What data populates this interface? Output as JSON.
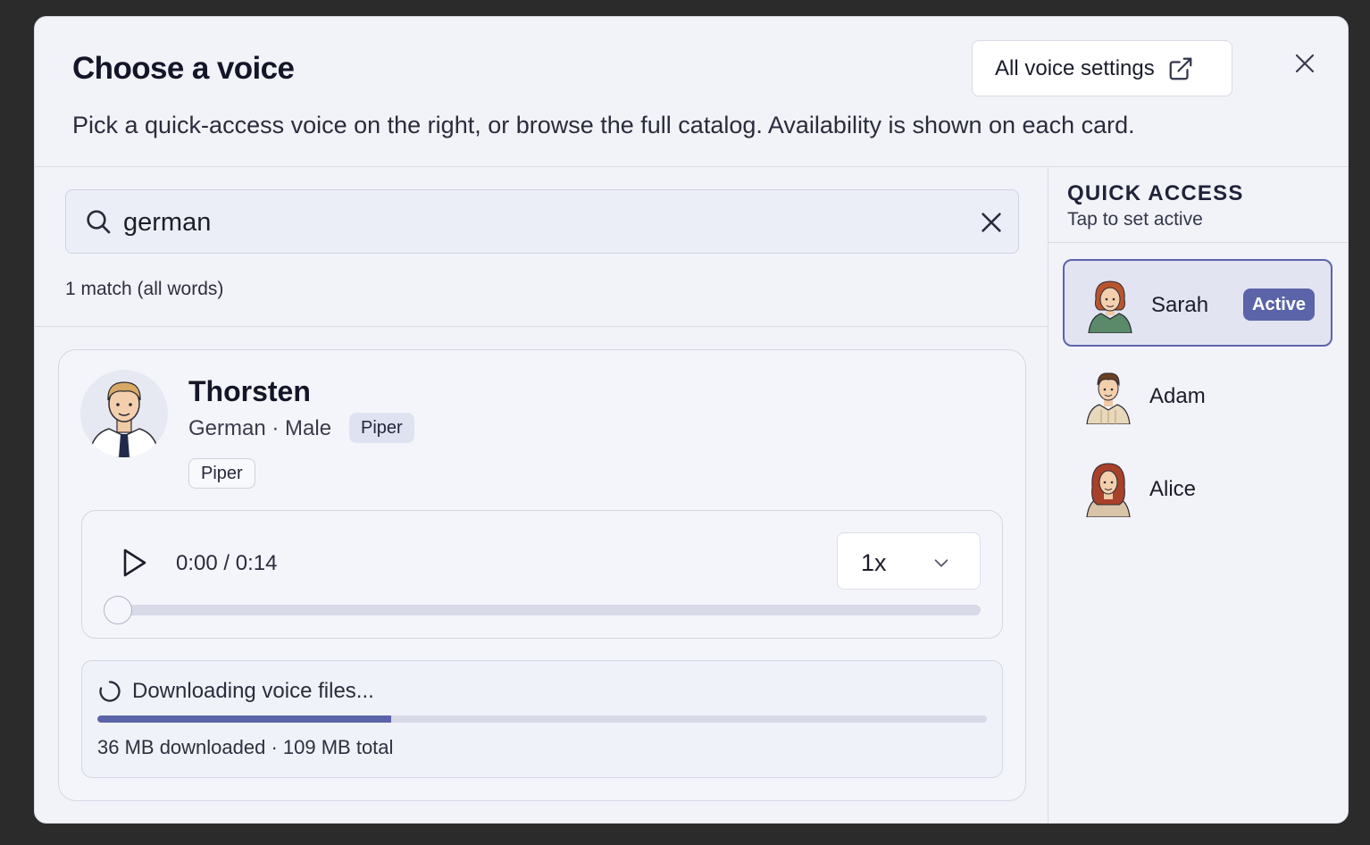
{
  "dialog": {
    "title": "Choose a voice",
    "subtitle": "Pick a quick-access voice on the right, or browse the full catalog. Availability is shown on each card.",
    "settings_button": "All voice settings",
    "close_icon": "close-icon"
  },
  "search": {
    "value": "german",
    "match_text": "1 match (all words)"
  },
  "voice_card": {
    "name": "Thorsten",
    "meta": "German · Male",
    "tag_primary": "Piper",
    "tag_secondary": "Piper",
    "player": {
      "time": "0:00 / 0:14",
      "speed": "1x",
      "progress_fraction": 0.0
    },
    "download": {
      "label": "Downloading voice files...",
      "info": "36 MB downloaded · 109 MB total",
      "progress_fraction": 0.33
    }
  },
  "quick_access": {
    "title": "QUICK ACCESS",
    "subtitle": "Tap to set active",
    "items": [
      {
        "name": "Sarah",
        "active": true,
        "badge": "Active"
      },
      {
        "name": "Adam",
        "active": false
      },
      {
        "name": "Alice",
        "active": false
      }
    ]
  },
  "colors": {
    "accent": "#5b64a8",
    "background": "#f2f3f9",
    "backdrop": "#2b2b2b"
  }
}
